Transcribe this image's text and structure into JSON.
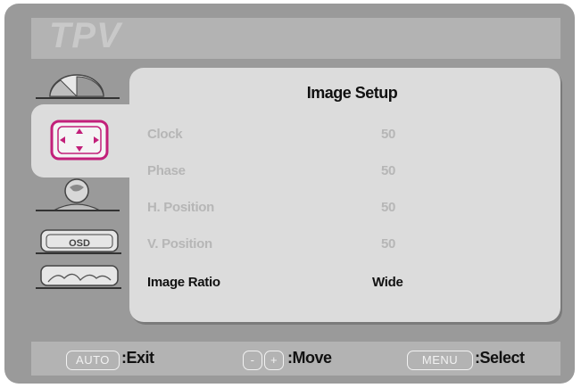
{
  "brand": "TPV",
  "menu": {
    "title": "Image Setup",
    "items": [
      {
        "label": "Clock",
        "value": "50"
      },
      {
        "label": "Phase",
        "value": "50"
      },
      {
        "label": "H. Position",
        "value": "50"
      },
      {
        "label": "V. Position",
        "value": "50"
      },
      {
        "label": "Image Ratio",
        "value": "Wide"
      }
    ]
  },
  "tabs": [
    {
      "icon": "picture-pie-icon"
    },
    {
      "icon": "image-position-icon"
    },
    {
      "icon": "color-globe-icon"
    },
    {
      "icon": "osd-settings-icon"
    },
    {
      "icon": "extra-settings-icon"
    }
  ],
  "footer": {
    "auto_key": "AUTO",
    "auto_text": ":Exit",
    "minus_key": "-",
    "plus_key": "+",
    "move_text": ":Move",
    "menu_key": "MENU",
    "select_text": ":Select"
  },
  "colors": {
    "frame": "#9a9a9a",
    "panel": "#dcdcdc",
    "highlight_icon": "#c2207a"
  }
}
